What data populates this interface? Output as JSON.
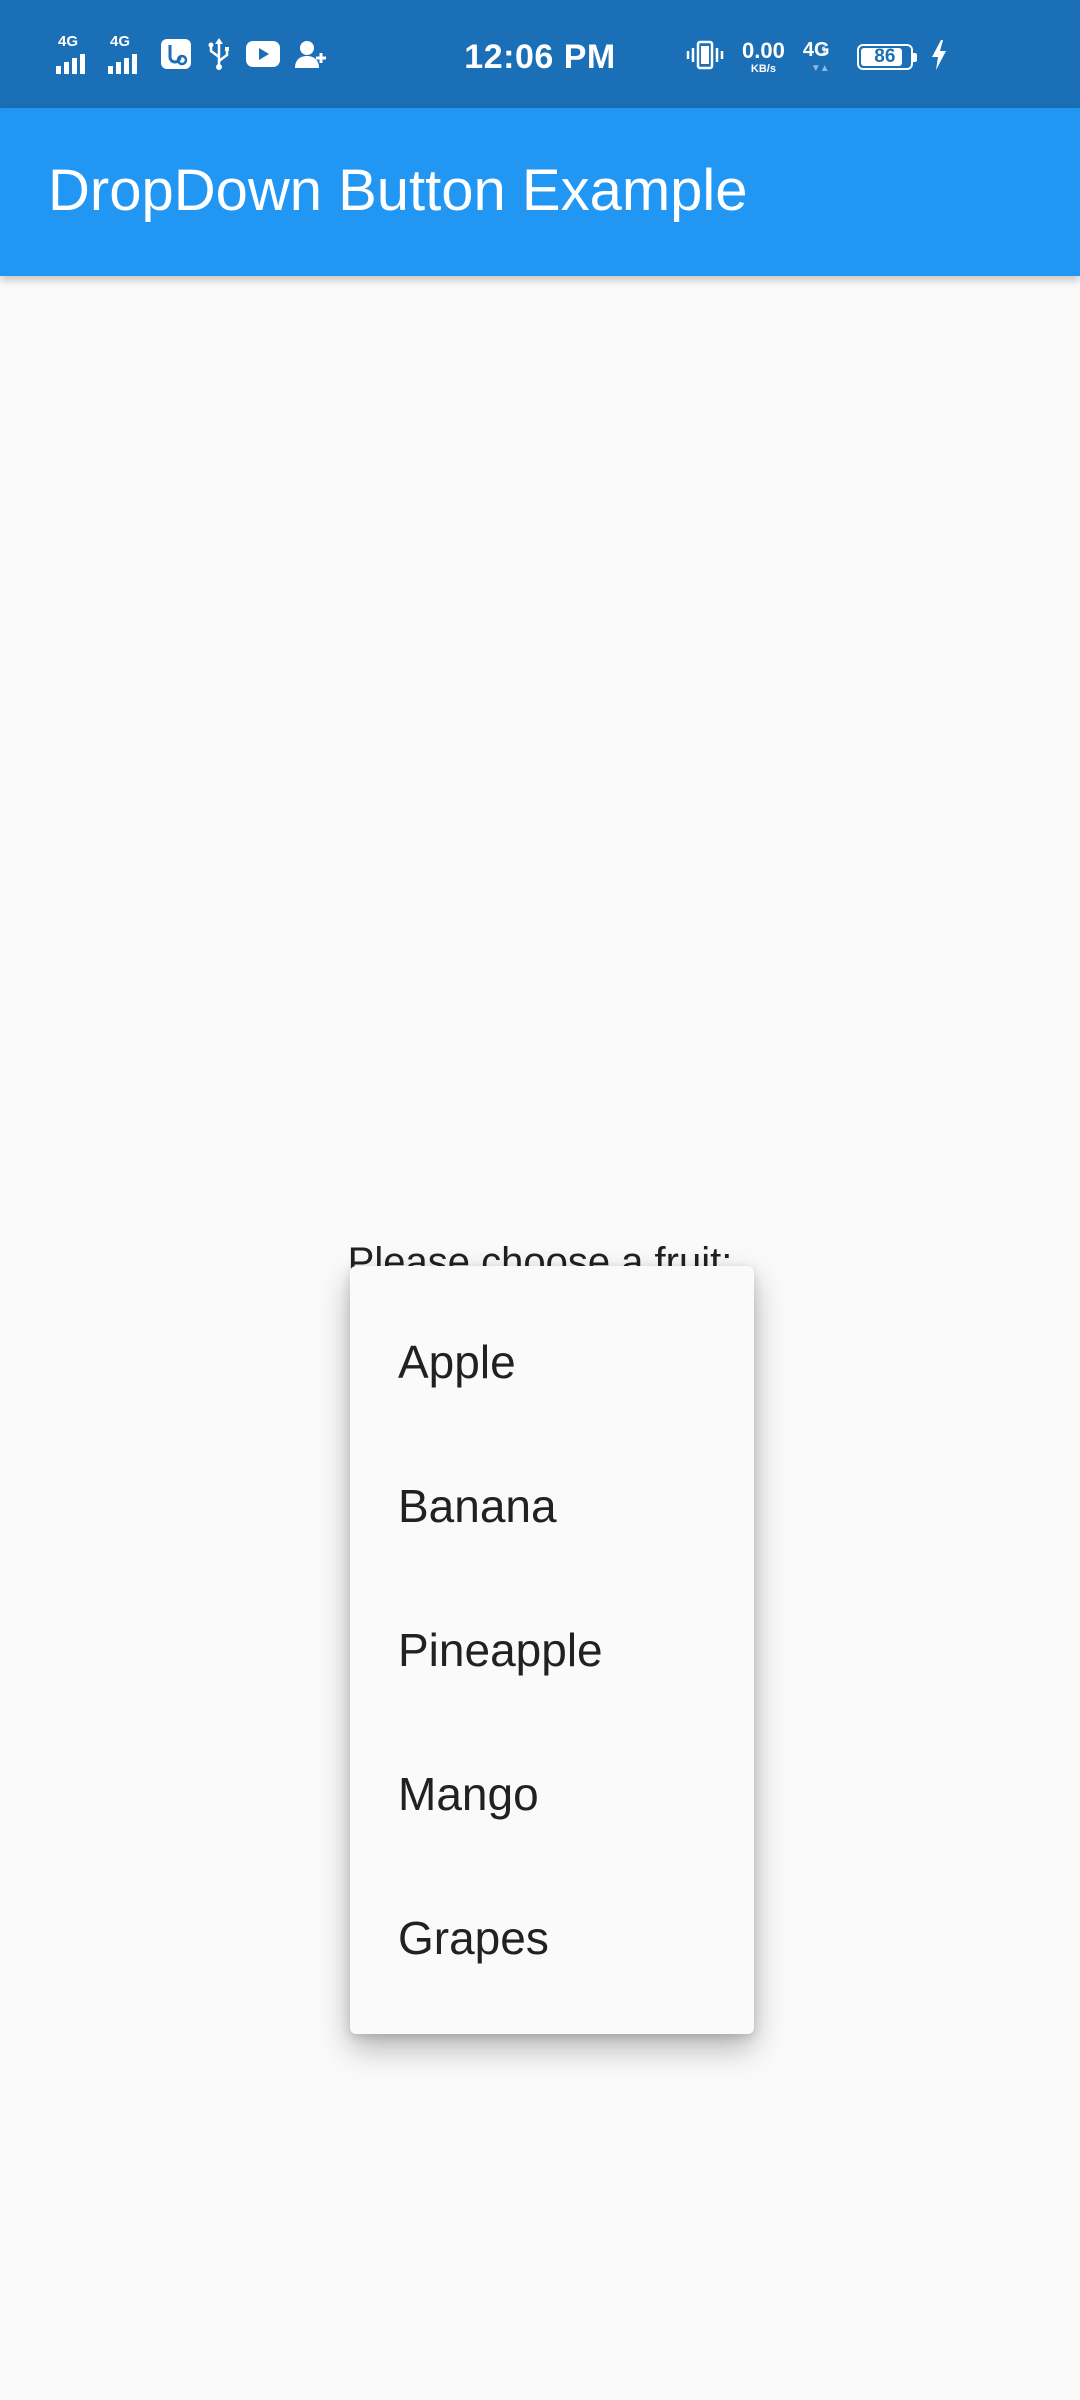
{
  "status_bar": {
    "network_labels": [
      "4G",
      "4G"
    ],
    "signal_levels": [
      1.0,
      1.0
    ],
    "icons": [
      "signal-4g-icon",
      "signal-4g-icon",
      "usb-settings-icon",
      "usb-icon",
      "youtube-icon",
      "add-person-icon",
      "vibrate-icon",
      "charging-icon"
    ],
    "time": "12:06 PM",
    "net_speed_value": "0.00",
    "net_speed_unit": "KB/s",
    "data_network": "4G",
    "data_network_sub": "1",
    "battery_level": "86",
    "battery_fraction": 0.86
  },
  "app_bar": {
    "title": "DropDown Button Example"
  },
  "main": {
    "prompt": "Please choose a fruit:"
  },
  "dropdown": {
    "options": [
      "Apple",
      "Banana",
      "Pineapple",
      "Mango",
      "Grapes"
    ]
  },
  "colors": {
    "status_bar_bg": "#1a6fb6",
    "app_bar_bg": "#2196f3",
    "background": "#fafafa",
    "text": "#212121"
  }
}
